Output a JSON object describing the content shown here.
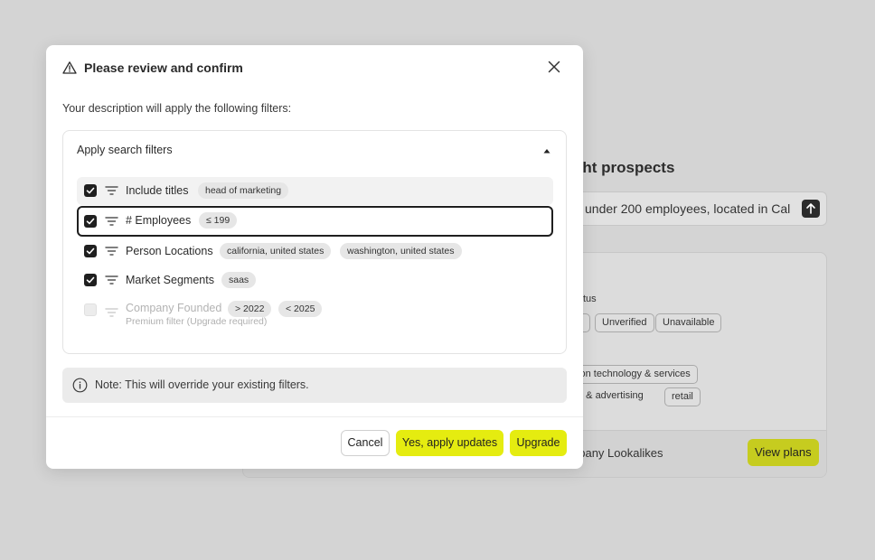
{
  "background": {
    "heading": "ght prospects",
    "search_text": "under 200 employees, located in Cal",
    "status_label": "tus",
    "status_chips": [
      "",
      "Unverified",
      "Unavailable"
    ],
    "industry_chips_row1": [
      "tion technology & services"
    ],
    "industry_chips_row2": [
      "g & advertising",
      "retail"
    ],
    "footer_text": "npany Lookalikes",
    "view_plans_label": "View plans",
    "send_icon": "arrow-up-icon"
  },
  "modal": {
    "title": "Please review and confirm",
    "title_icon": "warning-icon",
    "description": "Your description will apply the following filters:",
    "filters_section": {
      "heading": "Apply search filters",
      "filters": [
        {
          "label": "Include titles",
          "checked": true,
          "values": [
            "head of marketing"
          ]
        },
        {
          "label": "# Employees",
          "checked": true,
          "values": [
            "≤ 199"
          ]
        },
        {
          "label": "Person Locations",
          "checked": true,
          "values": [
            "california, united states",
            "washington, united states"
          ]
        },
        {
          "label": "Market Segments",
          "checked": true,
          "values": [
            "saas"
          ]
        },
        {
          "label": "Company Founded",
          "checked": false,
          "disabled": true,
          "values": [
            "> 2022",
            "< 2025"
          ],
          "sublabel": "Premium filter (Upgrade required)"
        }
      ]
    },
    "note": "Note: This will override your existing filters.",
    "buttons": {
      "cancel": "Cancel",
      "apply": "Yes, apply updates",
      "upgrade": "Upgrade"
    }
  },
  "colors": {
    "accent": "#e5ec10",
    "overlay": "#d4d4d4",
    "checkbox": "#1f1f1f"
  }
}
